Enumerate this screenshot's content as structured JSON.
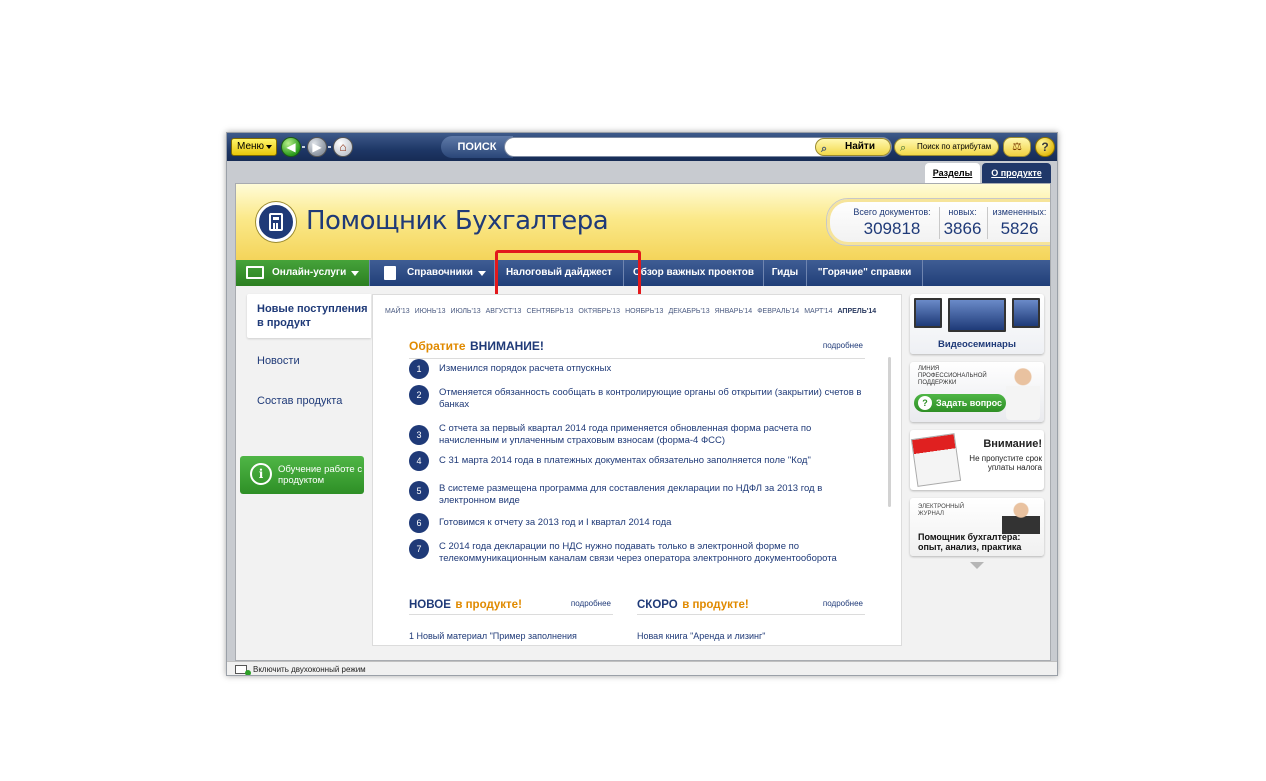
{
  "toolbar": {
    "menu_label": "Меню",
    "search_label": "ПОИСК",
    "search_value": "",
    "find_label": "Найти",
    "attr_search_label": "Поиск по атрибутам",
    "help_label": "?"
  },
  "tabs": {
    "sections": "Разделы",
    "about": "О продукте"
  },
  "banner": {
    "title": "Помощник Бухгалтера",
    "counters": {
      "total_label": "Всего документов:",
      "total_value": "309818",
      "new_label": "новых:",
      "new_value": "3866",
      "changed_label": "измененных:",
      "changed_value": "5826"
    }
  },
  "menu": {
    "online": "Онлайн-услуги",
    "refs": "Справочники",
    "digest": "Налоговый дайджест",
    "reviews": "Обзор важных проектов",
    "guides": "Гиды",
    "hot": "\"Горячие\" справки"
  },
  "left_nav": {
    "new_items": "Новые поступления в продукт",
    "news": "Новости",
    "composition": "Состав продукта",
    "training": "Обучение работе с продуктом"
  },
  "months": [
    "МАЙ'13",
    "ИЮНЬ'13",
    "ИЮЛЬ'13",
    "АВГУСТ'13",
    "СЕНТЯБРЬ'13",
    "ОКТЯБРЬ'13",
    "НОЯБРЬ'13",
    "ДЕКАБРЬ'13",
    "ЯНВАРЬ'14",
    "ФЕВРАЛЬ'14",
    "МАРТ'14",
    "АПРЕЛЬ'14"
  ],
  "attention": {
    "word1": "Обратите",
    "word2": "ВНИМАНИЕ!",
    "more": "подробнее"
  },
  "news": [
    {
      "num": "1",
      "text": "Изменился порядок расчета отпускных"
    },
    {
      "num": "2",
      "text": "Отменяется обязанность сообщать в контролирующие органы об открытии (закрытии) счетов в банках"
    },
    {
      "num": "3",
      "text": "С отчета за первый квартал 2014 года применяется обновленная форма расчета по начисленным и уплаченным страховым взносам (форма-4 ФСС)"
    },
    {
      "num": "4",
      "text": "С 31 марта 2014 года в платежных документах обязательно заполняется поле \"Код\""
    },
    {
      "num": "5",
      "text": "В системе размещена программа для составления декларации по НДФЛ за 2013 год в электронном виде"
    },
    {
      "num": "6",
      "text": "Готовимся к отчету за 2013 год и I квартал 2014 года"
    },
    {
      "num": "7",
      "text": "С 2014 года декларации по НДС нужно подавать только в электронной форме по телекоммуникационным каналам связи через оператора электронного документооборота"
    }
  ],
  "new_in_product": {
    "h1": "НОВОЕ",
    "h2": "в продукте!",
    "more": "подробнее",
    "line": "1     Новый материал \"Пример заполнения"
  },
  "soon_in_product": {
    "h1": "СКОРО",
    "h2": "в продукте!",
    "more": "подробнее",
    "line": "Новая книга \"Аренда и лизинг\""
  },
  "right_cards": {
    "video": "Видеосеминары",
    "support_caption": "ЛИНИЯ ПРОФЕССИОНАЛЬНОЙ ПОДДЕРЖКИ",
    "ask": "Задать вопрос",
    "deadline_title": "Внимание!",
    "deadline_text": "Не пропустите срок уплаты налога",
    "journal_caption": "ЭЛЕКТРОННЫЙ ЖУРНАЛ",
    "journal_title": "Помощник бухгалтера: опыт, анализ, практика"
  },
  "status": {
    "dual_window": "Включить двухоконный режим"
  },
  "colors": {
    "brand_blue": "#1f3a78",
    "accent_orange": "#e08a00",
    "highlight_red": "#e2181c",
    "green": "#2e8f26"
  }
}
